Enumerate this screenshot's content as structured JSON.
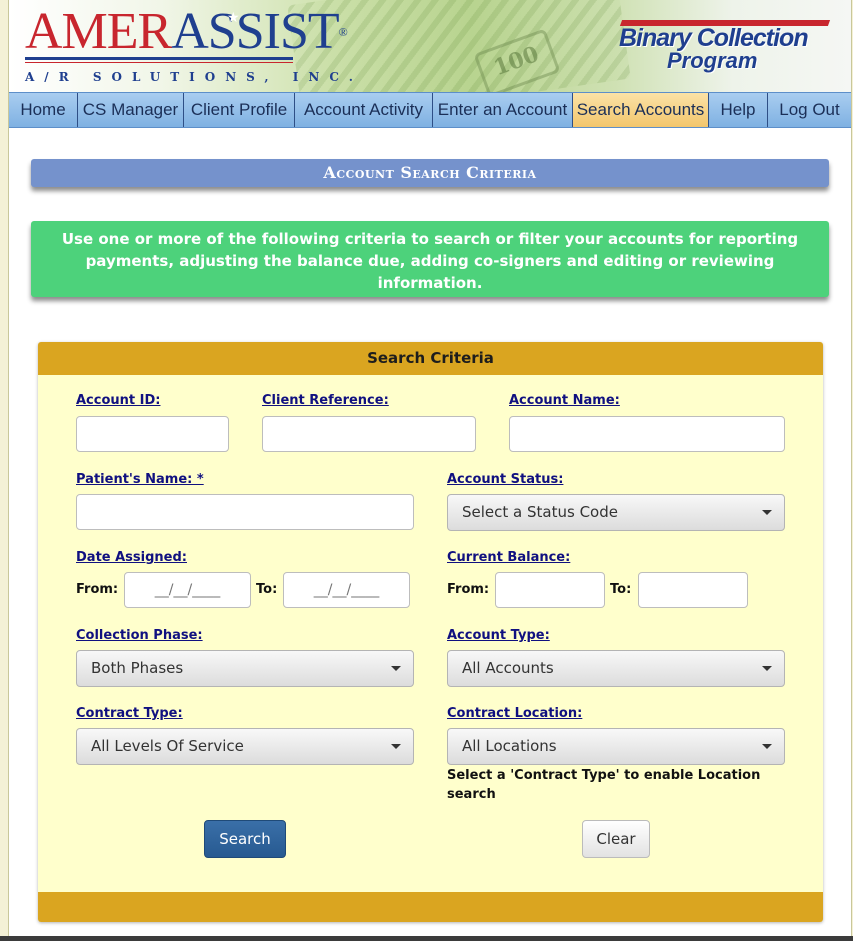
{
  "brand": {
    "logo_part1": "AMER",
    "logo_part2": "ASSIST",
    "logo_mark": "®",
    "logo_tagline": "A/R SOLUTIONS, INC.",
    "program_line1": "Binary Collection",
    "program_line2": "Program",
    "banner_note": "100"
  },
  "nav": {
    "items": [
      {
        "label": "Home"
      },
      {
        "label": "CS Manager"
      },
      {
        "label": "Client Profile"
      },
      {
        "label": "Account Activity"
      },
      {
        "label": "Enter an Account"
      },
      {
        "label": "Search Accounts",
        "active": true
      },
      {
        "label": "Help"
      },
      {
        "label": "Log Out"
      }
    ]
  },
  "page": {
    "title": "Account Search Criteria",
    "info": "Use one or more of the following criteria to search or filter your accounts for reporting payments, adjusting the balance due, adding co-signers and editing or reviewing information."
  },
  "search": {
    "header": "Search Criteria",
    "account_id_label": "Account ID:",
    "account_id_value": "",
    "client_reference_label": "Client Reference:",
    "client_reference_value": "",
    "account_name_label": "Account Name:",
    "account_name_value": "",
    "patients_name_label": "Patient's Name: *",
    "patients_name_value": "",
    "account_status_label": "Account Status:",
    "account_status_value": "Select a Status Code",
    "date_assigned_label": "Date Assigned:",
    "date_from_label": "From:",
    "date_from_placeholder": "__/__/____",
    "date_to_label": "To:",
    "date_to_placeholder": "__/__/____",
    "current_balance_label": "Current Balance:",
    "balance_from_label": "From:",
    "balance_to_label": "To:",
    "collection_phase_label": "Collection Phase:",
    "collection_phase_value": "Both Phases",
    "account_type_label": "Account Type:",
    "account_type_value": "All Accounts",
    "contract_type_label": "Contract Type:",
    "contract_type_value": "All Levels Of Service",
    "contract_location_label": "Contract Location:",
    "contract_location_value": "All Locations",
    "location_note": "Select a 'Contract Type' to enable Location search",
    "search_button": "Search",
    "clear_button": "Clear"
  },
  "colors": {
    "nav_bg": "#8fbde8",
    "nav_active": "#f5cf80",
    "title_bar": "#7592cc",
    "info_box": "#4dd27b",
    "panel_bg": "#ffffcc",
    "panel_head": "#daa520",
    "search_button": "#2f639c"
  }
}
